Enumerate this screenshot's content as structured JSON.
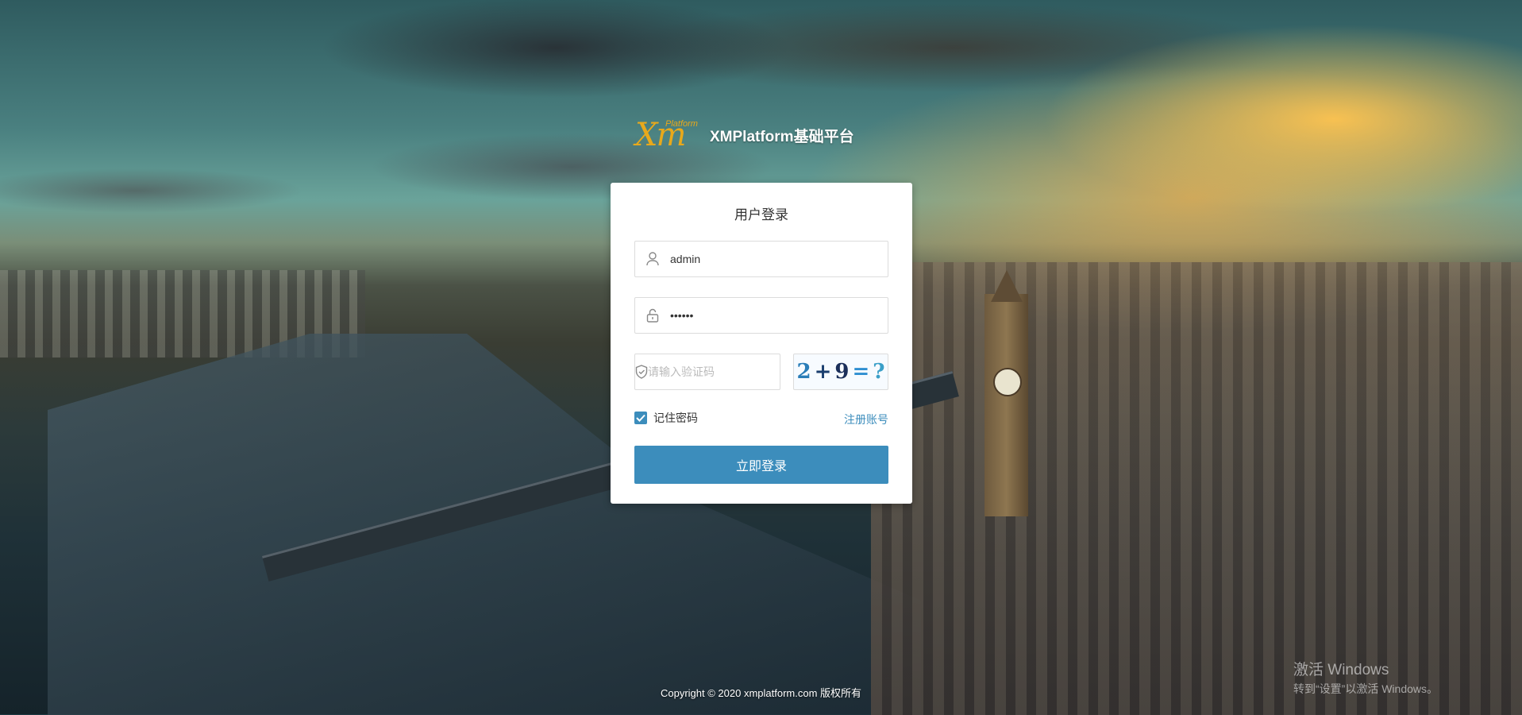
{
  "brand": {
    "logo_main": "Xm",
    "logo_sub": "Platform",
    "title": "XMPlatform基础平台"
  },
  "login": {
    "title": "用户登录",
    "username": {
      "value": "admin",
      "icon": "user-icon"
    },
    "password": {
      "value": "••••••",
      "icon": "lock-icon"
    },
    "captcha": {
      "placeholder": "请输入验证码",
      "icon": "shield-check-icon",
      "image_chars": [
        "2",
        "+",
        "9",
        "=",
        "?"
      ]
    },
    "remember_label": "记住密码",
    "remember_checked": true,
    "register_label": "注册账号",
    "submit_label": "立即登录"
  },
  "footer": {
    "copyright": "Copyright © 2020 xmplatform.com 版权所有"
  },
  "os_watermark": {
    "line1": "激活 Windows",
    "line2": "转到“设置”以激活 Windows。"
  },
  "colors": {
    "accent": "#3c8dbc",
    "brand_gold": "#e8a91c"
  }
}
